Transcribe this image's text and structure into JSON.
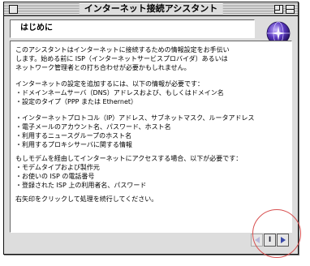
{
  "window": {
    "title": "インターネット接続アシスタント"
  },
  "header": {
    "title": "はじめに"
  },
  "content": {
    "lines": [
      "このアシスタントはインターネットに接続するための情報設定をお手伝い",
      "します。始める前に ISP（インターネットサービスプロバイダ）あるいは",
      "ネットワーク管理者との打ち合わせが必要かもしれません。",
      "インターネットの設定を追加するには、以下の情報が必要です：",
      "・ドメインネームサーバ（DNS）アドレスおよび、もしくはドメイン名",
      "・設定のタイプ（PPP または Ethernet）",
      "・インターネットプロトコル（IP）アドレス、サブネットマスク、ルータアドレス",
      "・電子メールのアカウント名、パスワード、ホスト名",
      "・利用するニュースグループのホスト名",
      "・利用するプロキシサーバに関する情報",
      "もしモデムを経由してインターネットにアクセスする場合、以下が必要です：",
      "・モデムタイプおよび製作元",
      "・お使いの ISP の電話番号",
      "・登録された ISP 上の利用者名、パスワード",
      "右矢印をクリックして処理を続行してください。"
    ]
  },
  "nav": {
    "index_glyph": "I"
  },
  "colors": {
    "window_bg": "#dddddd",
    "highlight": "#d85050",
    "arrow_active": "#3b4aa8",
    "globe": "#4a2aa0"
  },
  "icons": {
    "globe": "globe-icon",
    "back": "back-arrow-icon",
    "next": "next-arrow-icon"
  }
}
